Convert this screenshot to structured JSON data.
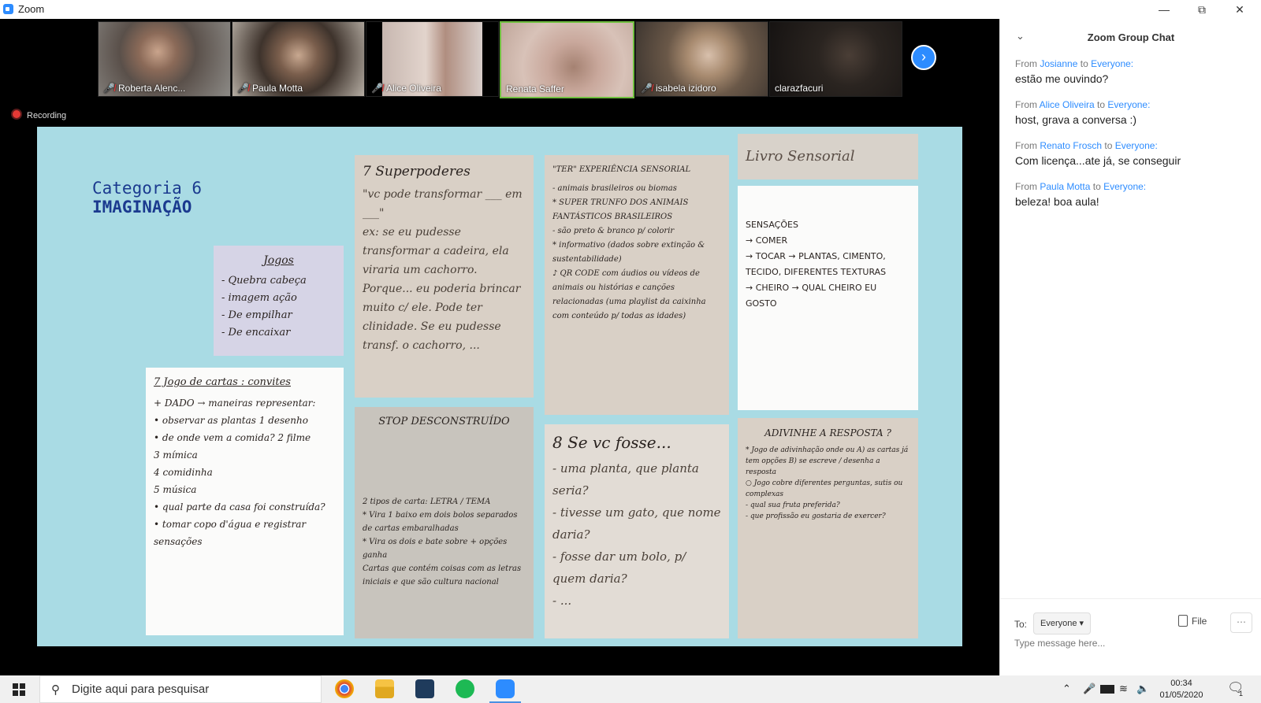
{
  "window": {
    "title": "Zoom"
  },
  "participants": [
    {
      "name": "Roberta Alenc...",
      "muted": true,
      "color": "#6e6560"
    },
    {
      "name": "Paula Motta",
      "muted": true,
      "color": "#8a7b70"
    },
    {
      "name": "Alice Oliveira",
      "muted": true,
      "color": "#a8989c"
    },
    {
      "name": "Renata Saffer",
      "muted": false,
      "color": "#b59a8f"
    },
    {
      "name": "isabela izidoro",
      "muted": true,
      "color": "#9a8a80"
    },
    {
      "name": "clarazfacuri",
      "muted": false,
      "color": "#2a2622"
    }
  ],
  "recording_label": "Recording",
  "slide": {
    "category_line1": "Categoria 6",
    "category_line2": "IMAGINAÇÃO",
    "notes": {
      "jogos": {
        "title": "Jogos",
        "lines": "- Quebra cabeça\n- imagem ação\n- De empilhar\n- De encaixar"
      },
      "cartas": {
        "title": "7 Jogo de cartas : convites",
        "lines": "+ DADO → maneiras representar:\n• observar as plantas   1 desenho\n• de onde vem a comida?   2 filme\n3 mímica\n4 comidinha\n5 música\n• qual parte da casa foi construída?\n• tomar copo d'água e registrar sensações"
      },
      "superpoderes": {
        "title": "7 Superpoderes",
        "lines": "\"vc pode transformar ___ em ___\"\nex: se eu pudesse transformar a cadeira, ela viraria um cachorro. Porque... eu poderia brincar muito c/ ele. Pode ter clinidade. Se eu pudesse transf. o cachorro, ..."
      },
      "stop": {
        "title": "STOP DESCONSTRUÍDO",
        "lines": "2 tipos de carta: LETRA / TEMA\n* Vira 1 baixo em dois bolos separados de cartas embaralhadas\n* Vira os dois e bate sobre + opções ganha\nCartas que contém coisas com as letras iniciais e que são cultura nacional"
      },
      "trunfo": {
        "title": "\"TER\" EXPERIÊNCIA SENSORIAL",
        "lines": "- animais brasileiros ou biomas\n* SUPER TRUNFO DOS ANIMAIS FANTÁSTICOS BRASILEIROS\n- são preto & branco p/ colorir\n* informativo (dados sobre extinção & sustentabilidade)\n♪ QR CODE com áudios ou vídeos de animais ou histórias e canções relacionadas (uma playlist da caixinha com conteúdo p/ todas as idades)"
      },
      "seoce": {
        "title": "8 Se vc fosse...",
        "lines": "- uma planta, que planta seria?\n- tivesse um gato, que nome daria?\n- fosse dar um bolo, p/ quem daria?\n- ..."
      },
      "livro_title": "Livro Sensorial",
      "livro": {
        "lines": "SENSAÇÕES\n→ COMER\n→ TOCAR → PLANTAS, CIMENTO, TECIDO, DIFERENTES TEXTURAS\n→ CHEIRO → QUAL CHEIRO EU GOSTO"
      },
      "adivinhe": {
        "title": "ADIVINHE A RESPOSTA ?",
        "lines": "* Jogo de adivinhação onde ou A) as cartas já tem opções B) se escreve / desenha a resposta\n○ Jogo cobre diferentes perguntas, sutis ou complexas\n- qual sua fruta preferida?\n- que profissão eu gostaria de exercer?"
      }
    }
  },
  "chat": {
    "title": "Zoom Group Chat",
    "messages": [
      {
        "from_prefix": "From",
        "from": "Josianne",
        "to_prefix": "to",
        "to": "Everyone:",
        "text": "estão me ouvindo?"
      },
      {
        "from_prefix": "From",
        "from": "Alice Oliveira",
        "to_prefix": "to",
        "to": "Everyone:",
        "text": "host, grava a conversa :)"
      },
      {
        "from_prefix": "From",
        "from": "Renato Frosch",
        "to_prefix": "to",
        "to": "Everyone:",
        "text": "Com licença...ate já, se conseguir"
      },
      {
        "from_prefix": "From",
        "from": "Paula Motta",
        "to_prefix": "to",
        "to": "Everyone:",
        "text": "beleza! boa aula!"
      }
    ],
    "to_label": "To:",
    "to_value": "Everyone",
    "file_label": "File",
    "input_placeholder": "Type message here..."
  },
  "taskbar": {
    "search_placeholder": "Digite aqui para pesquisar",
    "time": "00:34",
    "date": "01/05/2020",
    "notification_count": "1",
    "apps": [
      "chrome-icon",
      "file-explorer-icon",
      "store-icon",
      "spotify-icon",
      "zoom-icon"
    ]
  },
  "colors": {
    "accent": "#2d8cff",
    "slide_bg": "#a9dbe4",
    "heading": "#1b3a8f"
  }
}
